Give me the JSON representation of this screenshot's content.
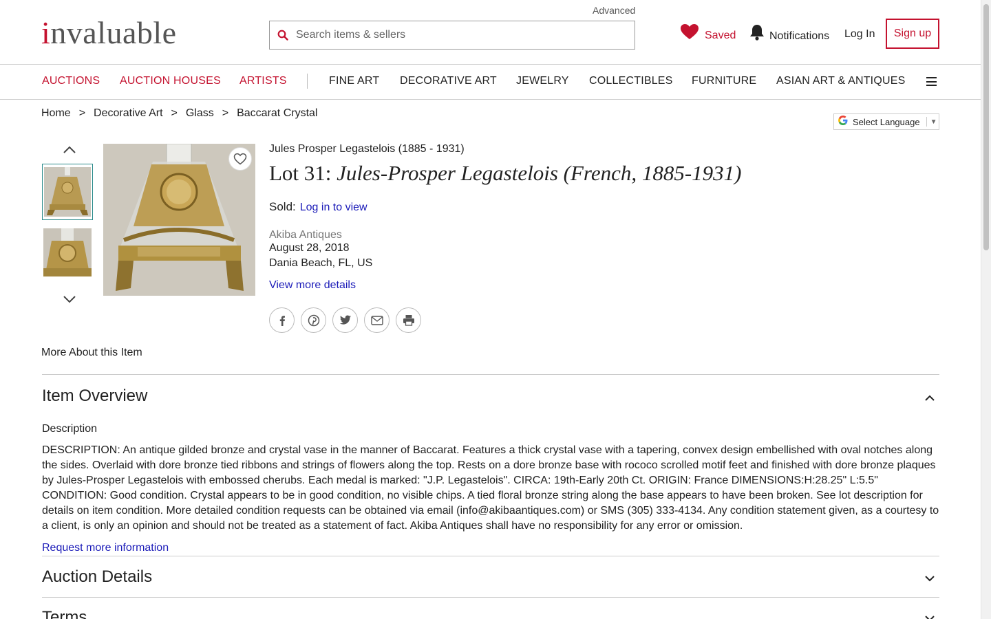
{
  "header": {
    "logo_accent": "i",
    "logo_rest": "nvaluable",
    "advanced_label": "Advanced",
    "search_placeholder": "Search items & sellers",
    "saved_label": "Saved",
    "notifications_label": "Notifications",
    "login_label": "Log In",
    "signup_label": "Sign up"
  },
  "nav": {
    "items_red": [
      "AUCTIONS",
      "AUCTION HOUSES",
      "ARTISTS"
    ],
    "items_dark": [
      "FINE ART",
      "DECORATIVE ART",
      "JEWELRY",
      "COLLECTIBLES",
      "FURNITURE",
      "ASIAN ART & ANTIQUES"
    ]
  },
  "breadcrumb": {
    "items": [
      "Home",
      "Decorative Art",
      "Glass",
      "Baccarat Crystal"
    ],
    "separator": ">"
  },
  "language": {
    "label": "Select Language"
  },
  "lot": {
    "artist_line": "Jules Prosper Legastelois (1885 - 1931)",
    "lot_prefix": "Lot 31:",
    "lot_name": "Jules-Prosper Legastelois (French, 1885-1931)",
    "sold_label": "Sold:",
    "sold_link": "Log in to view",
    "auction_house": "Akiba Antiques",
    "date": "August 28, 2018",
    "location": "Dania Beach, FL, US",
    "view_more": "View more details"
  },
  "more_about": "More About this Item",
  "overview": {
    "title": "Item Overview",
    "desc_label": "Description",
    "description": "DESCRIPTION: An antique gilded bronze and crystal vase in the manner of Baccarat. Features a thick crystal vase with a tapering, convex design embellished with oval notches along the sides. Overlaid with dore bronze tied ribbons and strings of flowers along the top. Rests on a dore bronze base with rococo scrolled motif feet and finished with dore bronze plaques by Jules-Prosper Legastelois with embossed cherubs. Each medal is marked: \"J.P. Legastelois\". CIRCA: 19th-Early 20th Ct. ORIGIN: France DIMENSIONS:H:28.25\" L:5.5\" CONDITION: Good condition. Crystal appears to be in good condition, no visible chips. A tied floral bronze string along the base appears to have been broken. See lot description for details on item condition. More detailed condition requests can be obtained via email (info@akibaantiques.com) or SMS (305) 333-4134. Any condition statement given, as a courtesy to a client, is only an opinion and should not be treated as a statement of fact. Akiba Antiques shall have no responsibility for any error or omission.",
    "request_link": "Request more information"
  },
  "auction_details": {
    "title": "Auction Details"
  },
  "terms": {
    "title": "Terms"
  },
  "colors": {
    "brand_red": "#c4122f",
    "link_blue": "#1a1ab8"
  }
}
